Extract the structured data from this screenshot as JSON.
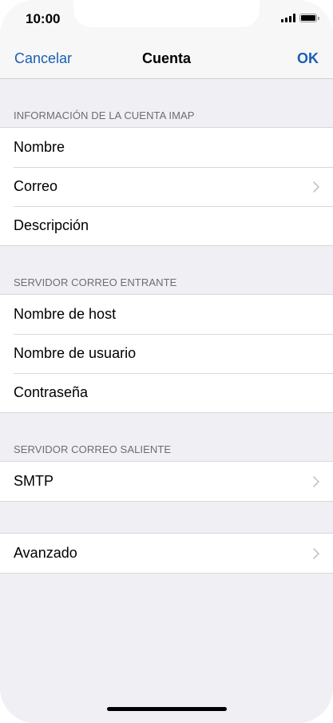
{
  "status_bar": {
    "time": "10:00"
  },
  "nav": {
    "cancel_label": "Cancelar",
    "title": "Cuenta",
    "ok_label": "OK"
  },
  "sections": {
    "imap": {
      "header": "INFORMACIÓN DE LA CUENTA IMAP",
      "items": [
        "Nombre",
        "Correo",
        "Descripción"
      ]
    },
    "incoming": {
      "header": "SERVIDOR CORREO ENTRANTE",
      "items": [
        "Nombre de host",
        "Nombre de usuario",
        "Contraseña"
      ]
    },
    "outgoing": {
      "header": "SERVIDOR CORREO SALIENTE",
      "items": [
        "SMTP"
      ]
    },
    "advanced": {
      "items": [
        "Avanzado"
      ]
    }
  },
  "colors": {
    "accent": "#1a5fb4",
    "background": "#efeff4",
    "separator": "#d8d8dc",
    "section_text": "#6d6d72"
  }
}
